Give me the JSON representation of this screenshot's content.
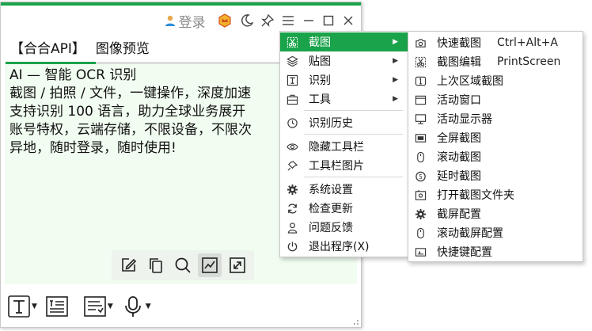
{
  "titlebar": {
    "login_label": "登录"
  },
  "tabs": [
    {
      "label": "【合合API】",
      "active": true
    },
    {
      "label": "图像预览",
      "active": false
    }
  ],
  "content": {
    "lines": [
      "AI — 智能 OCR 识别",
      "截图 / 拍照 / 文件，一键操作，深度加速",
      "支持识别 100   语言，助力全球业务展开",
      "账号特权，云端存储，不限设备，不限次",
      "异地，随时登录，随时使用!"
    ]
  },
  "main_menu": {
    "items": [
      {
        "label": "截图",
        "icon": "screenshot-scissors-icon",
        "has_submenu": true,
        "highlighted": true
      },
      {
        "label": "贴图",
        "icon": "layers-icon",
        "has_submenu": true
      },
      {
        "label": "识别",
        "icon": "text-recognize-icon",
        "has_submenu": true
      },
      {
        "label": "工具",
        "icon": "toolbox-icon",
        "has_submenu": true
      },
      {
        "label": "识别历史",
        "icon": "history-icon"
      },
      {
        "label": "隐藏工具栏",
        "icon": "eye-icon"
      },
      {
        "label": "工具栏图片",
        "icon": "pin-tool-icon"
      },
      {
        "label": "系统设置",
        "icon": "gear-icon"
      },
      {
        "label": "检查更新",
        "icon": "refresh-icon"
      },
      {
        "label": "问题反馈",
        "icon": "feedback-user-icon"
      },
      {
        "label": "退出程序(X)",
        "icon": "power-icon"
      }
    ]
  },
  "sub_menu": {
    "items": [
      {
        "label": "快速截图",
        "shortcut": "Ctrl+Alt+A",
        "icon": "camera-icon"
      },
      {
        "label": "截图编辑",
        "shortcut": "PrintScreen",
        "icon": "scissors-icon"
      },
      {
        "label": "上次区域截图",
        "icon": "last-region-icon"
      },
      {
        "label": "活动窗口",
        "icon": "window-icon"
      },
      {
        "label": "活动显示器",
        "icon": "monitor-icon"
      },
      {
        "label": "全屏截图",
        "icon": "fullscreen-icon"
      },
      {
        "label": "滚动截图",
        "icon": "mouse-icon"
      },
      {
        "label": "延时截图",
        "icon": "timer-icon"
      },
      {
        "label": "打开截图文件夹",
        "icon": "folder-image-icon"
      },
      {
        "label": "截屏配置",
        "icon": "gear-icon"
      },
      {
        "label": "滚动截屏配置",
        "icon": "mouse-scroll-icon"
      },
      {
        "label": "快捷键配置",
        "icon": "keyboard-icon"
      }
    ]
  },
  "colors": {
    "accent": "#1aa34a",
    "content_bg": "#f1fdf1",
    "menu_highlight": "#1aa34a"
  }
}
